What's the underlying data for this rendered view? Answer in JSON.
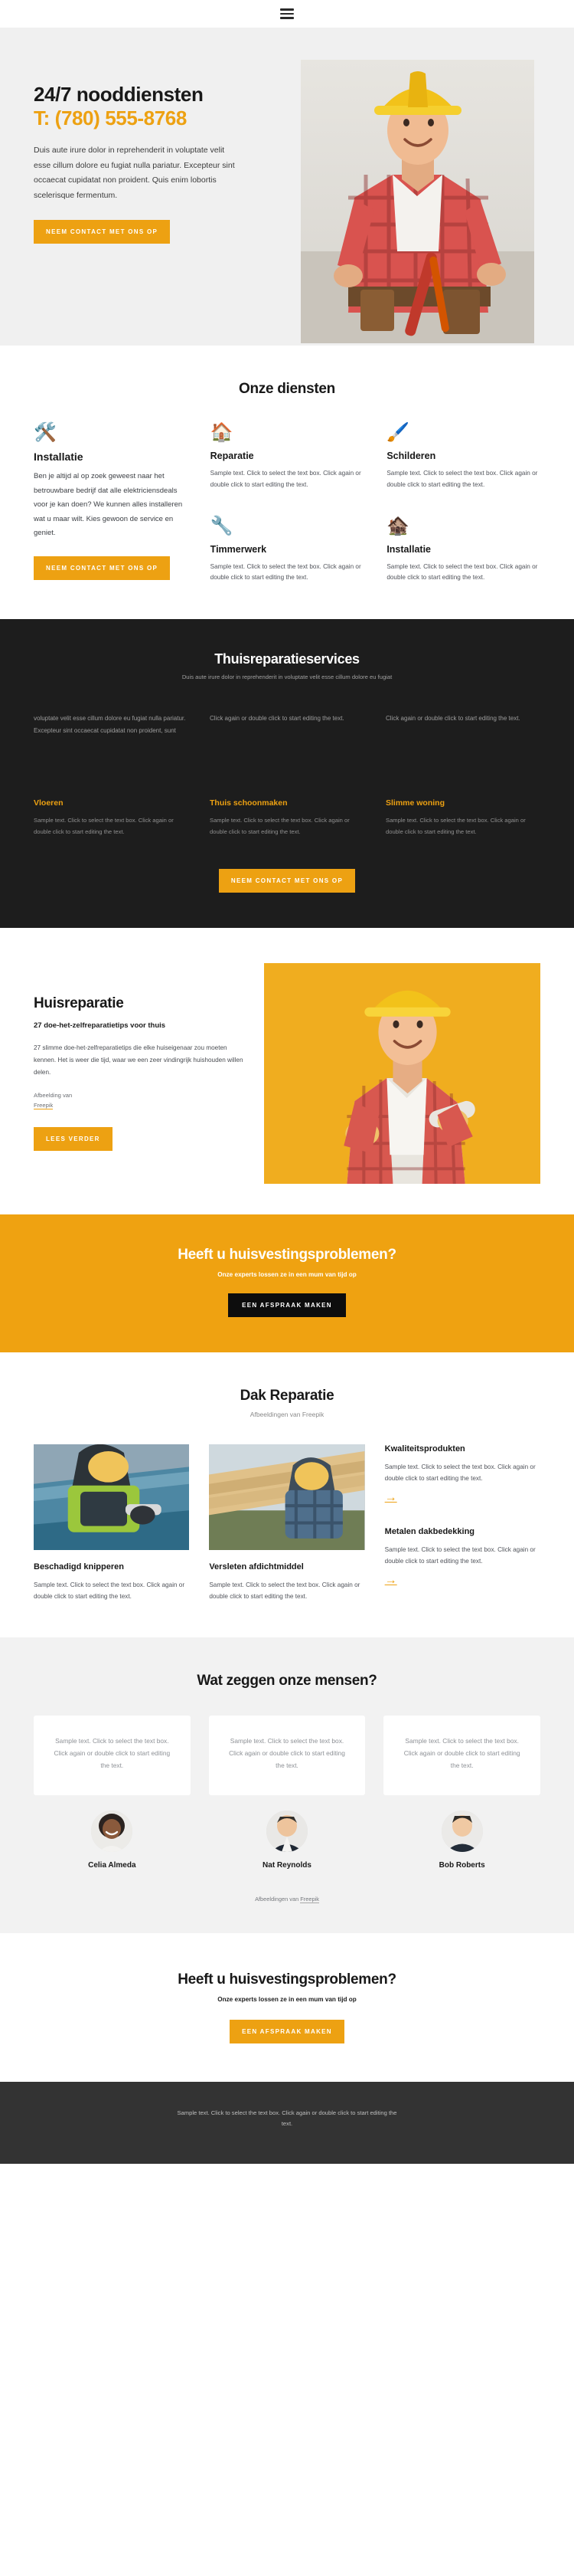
{
  "nav": {
    "menu_icon": "hamburger-menu-icon"
  },
  "hero": {
    "title": "24/7 nooddiensten",
    "phone": "T: (780) 555-8768",
    "body": "Duis aute irure dolor in reprehenderit in voluptate velit esse cillum dolore eu fugiat nulla pariatur. Excepteur sint occaecat cupidatat non proident. Quis enim lobortis scelerisque fermentum.",
    "cta": "NEEM CONTACT MET ONS OP",
    "image_alt": "worker-in-yellow-hard-hat-with-tool-belt"
  },
  "services": {
    "title": "Onze diensten",
    "items": [
      {
        "icon": "crossed-tools-icon",
        "title": "Installatie",
        "text": "Ben je altijd al op zoek geweest naar het betrouwbare bedrijf dat alle elektriciensdeals voor je kan doen? We kunnen alles installeren wat u maar wilt. Kies gewoon de service en geniet.",
        "cta": "NEEM CONTACT MET ONS OP"
      },
      {
        "icon": "house-with-wrench-icon",
        "title": "Reparatie",
        "text": "Sample text. Click to select the text box. Click again or double click to start editing the text."
      },
      {
        "icon": "paint-roller-icon",
        "title": "Schilderen",
        "text": "Sample text. Click to select the text box. Click again or double click to start editing the text."
      },
      {
        "icon": "power-drill-icon",
        "title": "Timmerwerk",
        "text": "Sample text. Click to select the text box. Click again or double click to start editing the text."
      },
      {
        "icon": "house-with-toolbox-icon",
        "title": "Installatie",
        "text": "Sample text. Click to select the text box. Click again or double click to start editing the text."
      }
    ]
  },
  "dark": {
    "title": "Thuisreparatieservices",
    "subtitle": "Duis aute irure dolor in reprehenderit in voluptate velit esse cillum dolore eu fugiat",
    "columns": [
      {
        "top": "voluptate velit esse cillum dolore eu fugiat nulla pariatur. Excepteur sint occaecat cupidatat non proident, sunt",
        "heading": "Vloeren",
        "body": "Sample text. Click to select the text box. Click again or double click to start editing the text."
      },
      {
        "top": "Click again or double click to start editing the text.",
        "heading": "Thuis schoonmaken",
        "body": "Sample text. Click to select the text box. Click again or double click to start editing the text."
      },
      {
        "top": "Click again or double click to start editing the text.",
        "heading": "Slimme woning",
        "body": "Sample text. Click to select the text box. Click again or double click to start editing the text."
      }
    ],
    "cta": "NEEM CONTACT MET ONS OP"
  },
  "repair": {
    "title": "Huisreparatie",
    "lead": "27 doe-het-zelfreparatietips voor thuis",
    "body": "27 slimme doe-het-zelfreparatietips die elke huiseigenaar zou moeten kennen. Het is weer die tijd, waar we een zeer vindingrijk huishouden willen delen.",
    "credit_prefix": "Afbeelding van",
    "credit_link": "Freepik",
    "cta": "LEES VERDER",
    "image_alt": "smiling-woman-builder-with-hard-hat-on-yellow-background"
  },
  "cta_mid": {
    "title": "Heeft u huisvestingsproblemen?",
    "subtitle": "Onze experts lossen ze in een mum van tijd op",
    "button": "EEN AFSPRAAK MAKEN"
  },
  "roof": {
    "title": "Dak Reparatie",
    "subtitle": "Afbeeldingen van Freepik",
    "cards": [
      {
        "image_alt": "roofer-cutting-metal-roofing-sheet",
        "title": "Beschadigd knipperen",
        "text": "Sample text. Click to select the text box. Click again or double click to start editing the text."
      },
      {
        "image_alt": "worker-carrying-timber-on-roof",
        "title": "Versleten afdichtmiddel",
        "text": "Sample text. Click to select the text box. Click again or double click to start editing the text."
      }
    ],
    "features": [
      {
        "title": "Kwaliteitsprodukten",
        "text": "Sample text. Click to select the text box. Click again or double click to start editing the text.",
        "arrow": "arrow-right-icon"
      },
      {
        "title": "Metalen dakbedekking",
        "text": "Sample text. Click to select the text box. Click again or double click to start editing the text.",
        "arrow": "arrow-right-icon"
      }
    ]
  },
  "testimonials": {
    "title": "Wat zeggen onze mensen?",
    "items": [
      {
        "quote": "Sample text. Click to select the text box. Click again or double click to start editing the text.",
        "name": "Celia Almeda",
        "avatar_alt": "smiling-woman-with-curly-hair"
      },
      {
        "quote": "Sample text. Click to select the text box. Click again or double click to start editing the text.",
        "name": "Nat Reynolds",
        "avatar_alt": "man-in-dark-suit"
      },
      {
        "quote": "Sample text. Click to select the text box. Click again or double click to start editing the text.",
        "name": "Bob Roberts",
        "avatar_alt": "man-in-dark-shirt"
      }
    ],
    "credit_prefix": "Afbeeldingen van",
    "credit_link": "Freepik"
  },
  "cta_bottom": {
    "title": "Heeft u huisvestingsproblemen?",
    "subtitle": "Onze experts lossen ze in een mum van tijd op",
    "button": "EEN AFSPRAAK MAKEN"
  },
  "footer": {
    "text": "Sample text. Click to select the text box. Click again or double click to start editing the text."
  },
  "colors": {
    "accent": "#eda112",
    "dark": "#1d1d1d",
    "footer": "#333333",
    "hero_bg": "#f0f0f0",
    "testimonial_bg": "#f2f2f2"
  }
}
